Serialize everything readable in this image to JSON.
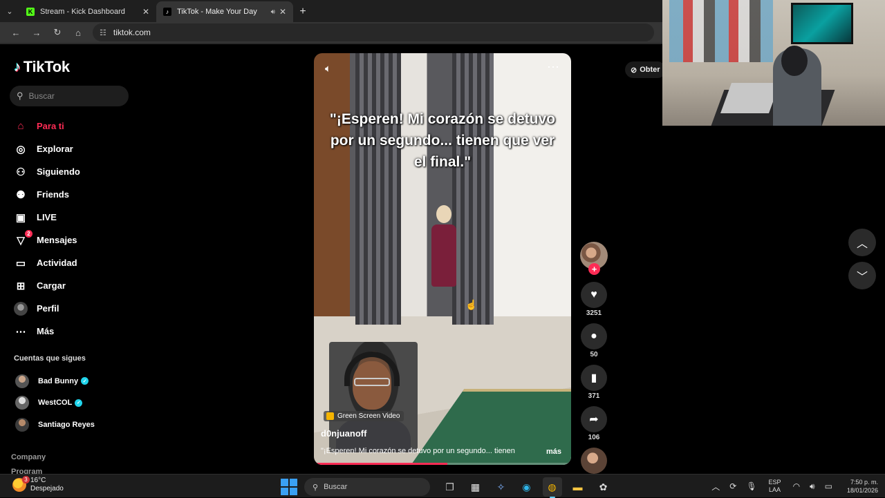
{
  "browser": {
    "tabs": [
      {
        "title": "Stream - Kick Dashboard",
        "favicon": "kick-icon",
        "active": false
      },
      {
        "title": "TikTok - Make Your Day",
        "favicon": "tiktok-icon",
        "active": true,
        "audio": true
      }
    ],
    "url": "tiktok.com"
  },
  "sidebar": {
    "logo": "TikTok",
    "search_placeholder": "Buscar",
    "nav": [
      {
        "label": "Para ti",
        "icon": "home-icon",
        "active": true
      },
      {
        "label": "Explorar",
        "icon": "compass-icon"
      },
      {
        "label": "Siguiendo",
        "icon": "following-icon"
      },
      {
        "label": "Friends",
        "icon": "friends-icon"
      },
      {
        "label": "LIVE",
        "icon": "live-icon"
      },
      {
        "label": "Mensajes",
        "icon": "messages-icon",
        "badge": "2"
      },
      {
        "label": "Actividad",
        "icon": "activity-icon"
      },
      {
        "label": "Cargar",
        "icon": "upload-icon"
      },
      {
        "label": "Perfil",
        "icon": "profile-avatar"
      },
      {
        "label": "Más",
        "icon": "more-icon"
      }
    ],
    "following_title": "Cuentas que sigues",
    "following": [
      {
        "name": "Bad Bunny",
        "verified": true
      },
      {
        "name": "WestCOL",
        "verified": true
      },
      {
        "name": "Santiago Reyes",
        "verified": false
      }
    ],
    "footer": [
      "Company",
      "Program"
    ]
  },
  "video": {
    "overlay_text": "\"¡Esperen! Mi corazón se detuvo por un segundo... tienen que ver el final.\"",
    "effect_label": "Green Screen Video",
    "author": "d0njuanoff",
    "description": "\"¡Esperen! Mi corazón se detuvo por un segundo... tienen",
    "more_label": "más",
    "progress": 0.52
  },
  "actions": {
    "likes": "3251",
    "comments": "50",
    "saves": "371",
    "shares": "106"
  },
  "get_app_label": "Obter",
  "taskbar": {
    "weather_temp": "16°C",
    "weather_desc": "Despejado",
    "weather_badge": "3",
    "search_placeholder": "Buscar",
    "lang_top": "ESP",
    "lang_bottom": "LAA",
    "time": "7:50 p. m.",
    "date": "18/01/2026"
  },
  "colors": {
    "accent": "#fe2c55",
    "verified": "#20d5ec"
  }
}
